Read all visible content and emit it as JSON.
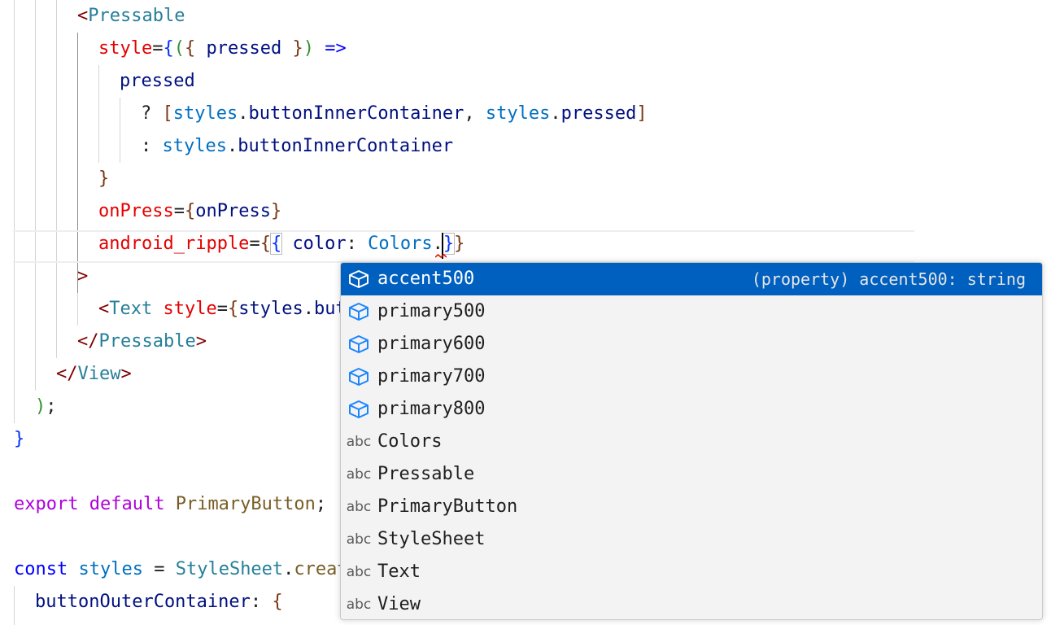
{
  "editor": {
    "lines": [
      [
        [
          "t-punct",
          "<"
        ],
        [
          "t-tag",
          "Pressable"
        ]
      ],
      [
        [
          "t-attr",
          "style"
        ],
        [
          "t-plain",
          "="
        ],
        [
          "t-brace1",
          "{"
        ],
        [
          "t-brace2",
          "("
        ],
        [
          "t-brace3",
          "{"
        ],
        [
          "t-plain",
          " "
        ],
        [
          "t-var",
          "pressed"
        ],
        [
          "t-plain",
          " "
        ],
        [
          "t-brace3",
          "}"
        ],
        [
          "t-brace2",
          ")"
        ],
        [
          "t-plain",
          " "
        ],
        [
          "t-keyword",
          "=>"
        ]
      ],
      [
        [
          "t-var",
          "pressed"
        ]
      ],
      [
        [
          "t-plain",
          "? "
        ],
        [
          "t-brace3",
          "["
        ],
        [
          "t-var2",
          "styles"
        ],
        [
          "t-plain",
          "."
        ],
        [
          "t-var",
          "buttonInnerContainer"
        ],
        [
          "t-plain",
          ", "
        ],
        [
          "t-var2",
          "styles"
        ],
        [
          "t-plain",
          "."
        ],
        [
          "t-var",
          "pressed"
        ],
        [
          "t-brace3",
          "]"
        ]
      ],
      [
        [
          "t-plain",
          ": "
        ],
        [
          "t-var2",
          "styles"
        ],
        [
          "t-plain",
          "."
        ],
        [
          "t-var",
          "buttonInnerContainer"
        ]
      ],
      [
        [
          "t-brace3",
          "}"
        ]
      ],
      [
        [
          "t-attr",
          "onPress"
        ],
        [
          "t-plain",
          "="
        ],
        [
          "t-brace3",
          "{"
        ],
        [
          "t-var",
          "onPress"
        ],
        [
          "t-brace3",
          "}"
        ]
      ],
      [
        [
          "t-attr",
          "android_ripple"
        ],
        [
          "t-plain",
          "="
        ],
        [
          "t-brace3",
          "{"
        ],
        [
          "t-brace1 bracket-box",
          "{"
        ],
        [
          "t-plain",
          " "
        ],
        [
          "t-var",
          "color"
        ],
        [
          "t-plain",
          ": "
        ],
        [
          "t-var2",
          "Colors"
        ],
        [
          "t-plain",
          "."
        ],
        [
          "t-brace1 bracket-box",
          "}"
        ],
        [
          "t-brace3",
          "}"
        ]
      ],
      [
        [
          "t-punct",
          ">"
        ]
      ],
      [
        [
          "t-punct",
          "<"
        ],
        [
          "t-tag",
          "Text"
        ],
        [
          "t-plain",
          " "
        ],
        [
          "t-attr",
          "style"
        ],
        [
          "t-plain",
          "="
        ],
        [
          "t-brace3",
          "{"
        ],
        [
          "t-var",
          "styles"
        ],
        [
          "t-plain",
          "."
        ],
        [
          "t-var",
          "but"
        ]
      ],
      [
        [
          "t-punct",
          "</"
        ],
        [
          "t-tag",
          "Pressable"
        ],
        [
          "t-punct",
          ">"
        ]
      ],
      [
        [
          "t-punct",
          "</"
        ],
        [
          "t-tag",
          "View"
        ],
        [
          "t-punct",
          ">"
        ]
      ],
      [
        [
          "t-brace2",
          ")"
        ],
        [
          "t-plain",
          ";"
        ]
      ],
      [
        [
          "t-brace1",
          "}"
        ]
      ],
      [],
      [
        [
          "t-ctrl",
          "export"
        ],
        [
          "t-plain",
          " "
        ],
        [
          "t-ctrl",
          "default"
        ],
        [
          "t-plain",
          " "
        ],
        [
          "t-func",
          "PrimaryButton"
        ],
        [
          "t-plain",
          ";"
        ]
      ],
      [],
      [
        [
          "t-keyword",
          "const"
        ],
        [
          "t-plain",
          " "
        ],
        [
          "t-var2",
          "styles"
        ],
        [
          "t-plain",
          " = "
        ],
        [
          "t-type",
          "StyleSheet"
        ],
        [
          "t-plain",
          "."
        ],
        [
          "t-func",
          "creat"
        ]
      ],
      [
        [
          "t-var",
          "buttonOuterContainer"
        ],
        [
          "t-plain",
          ": "
        ],
        [
          "t-brace3",
          "{"
        ]
      ]
    ]
  },
  "suggest": {
    "items": [
      {
        "label": "accent500",
        "kind": "property-icon",
        "selected": true,
        "detail": "(property) accent500: string"
      },
      {
        "label": "primary500",
        "kind": "property-icon",
        "selected": false,
        "detail": ""
      },
      {
        "label": "primary600",
        "kind": "property-icon",
        "selected": false,
        "detail": ""
      },
      {
        "label": "primary700",
        "kind": "property-icon",
        "selected": false,
        "detail": ""
      },
      {
        "label": "primary800",
        "kind": "property-icon",
        "selected": false,
        "detail": ""
      },
      {
        "label": "Colors",
        "kind": "text-word-icon",
        "selected": false,
        "detail": ""
      },
      {
        "label": "Pressable",
        "kind": "text-word-icon",
        "selected": false,
        "detail": ""
      },
      {
        "label": "PrimaryButton",
        "kind": "text-word-icon",
        "selected": false,
        "detail": ""
      },
      {
        "label": "StyleSheet",
        "kind": "text-word-icon",
        "selected": false,
        "detail": ""
      },
      {
        "label": "Text",
        "kind": "text-word-icon",
        "selected": false,
        "detail": ""
      },
      {
        "label": "View",
        "kind": "text-word-icon",
        "selected": false,
        "detail": ""
      }
    ],
    "abc_glyph": "abc",
    "selected_color": "#0060c0",
    "property_icon_color": "#1a85ff"
  }
}
